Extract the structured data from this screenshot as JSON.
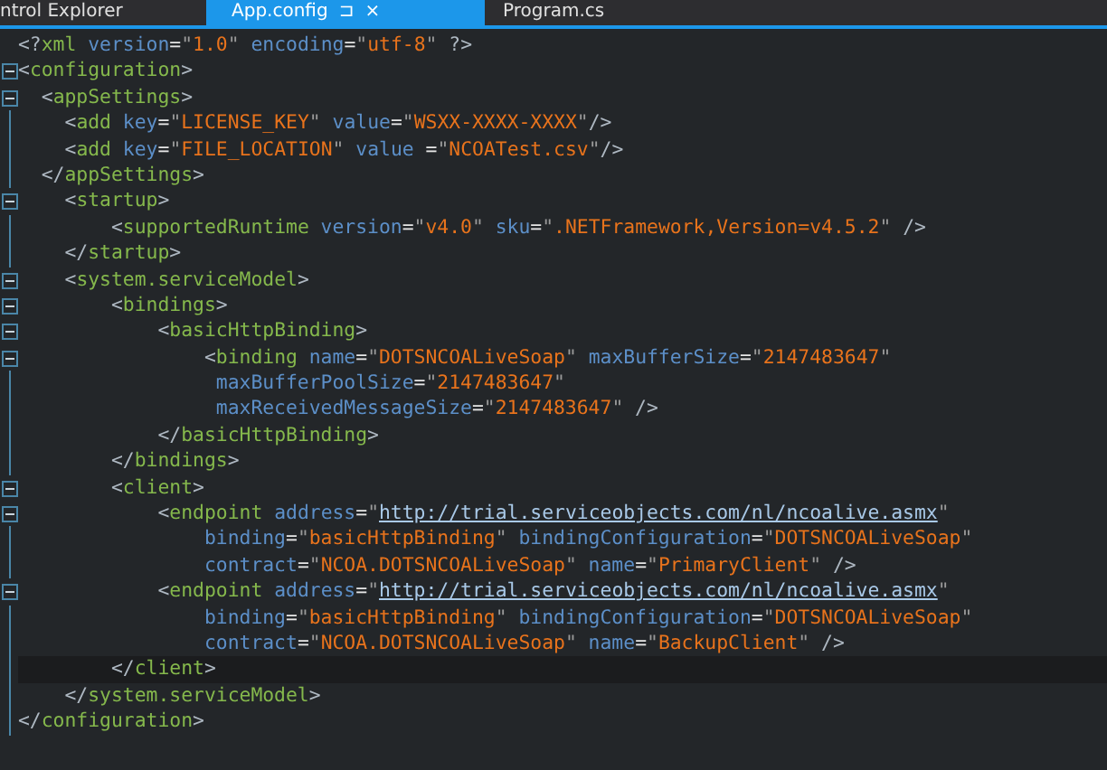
{
  "tabs": [
    {
      "label": "ntrol Explorer",
      "selected": false
    },
    {
      "label": "App.config",
      "selected": true,
      "pin": "⊐",
      "close": "×"
    },
    {
      "label": "Program.cs",
      "selected": false
    }
  ],
  "lines": [
    {
      "fold": false,
      "current": false,
      "tokens": [
        {
          "kind": "punct",
          "text": "<?"
        },
        {
          "kind": "tag",
          "text": "xml"
        },
        {
          "kind": "attr",
          "text": " version"
        },
        {
          "kind": "eq",
          "text": "="
        },
        {
          "kind": "quote",
          "text": "\""
        },
        {
          "kind": "value",
          "text": "1.0"
        },
        {
          "kind": "quote",
          "text": "\""
        },
        {
          "kind": "attr",
          "text": " encoding"
        },
        {
          "kind": "eq",
          "text": "="
        },
        {
          "kind": "quote",
          "text": "\""
        },
        {
          "kind": "value",
          "text": "utf-8"
        },
        {
          "kind": "quote",
          "text": "\""
        },
        {
          "kind": "punct",
          "text": " ?>"
        }
      ]
    },
    {
      "fold": true,
      "current": false,
      "tokens": [
        {
          "kind": "punct",
          "text": "<"
        },
        {
          "kind": "tag",
          "text": "configuration"
        },
        {
          "kind": "punct",
          "text": ">"
        }
      ]
    },
    {
      "fold": true,
      "current": false,
      "tokens": [
        {
          "kind": "punct",
          "text": "  <"
        },
        {
          "kind": "tag",
          "text": "appSettings"
        },
        {
          "kind": "punct",
          "text": ">"
        }
      ]
    },
    {
      "fold": false,
      "current": false,
      "tokens": [
        {
          "kind": "punct",
          "text": "    <"
        },
        {
          "kind": "tag",
          "text": "add"
        },
        {
          "kind": "attr",
          "text": " key"
        },
        {
          "kind": "eq",
          "text": "="
        },
        {
          "kind": "quote",
          "text": "\""
        },
        {
          "kind": "value",
          "text": "LICENSE_KEY"
        },
        {
          "kind": "quote",
          "text": "\""
        },
        {
          "kind": "attr",
          "text": " value"
        },
        {
          "kind": "eq",
          "text": "="
        },
        {
          "kind": "quote",
          "text": "\""
        },
        {
          "kind": "value",
          "text": "WSXX-XXXX-XXXX"
        },
        {
          "kind": "quote",
          "text": "\""
        },
        {
          "kind": "punct",
          "text": "/>"
        }
      ]
    },
    {
      "fold": false,
      "current": false,
      "tokens": [
        {
          "kind": "punct",
          "text": "    <"
        },
        {
          "kind": "tag",
          "text": "add"
        },
        {
          "kind": "attr",
          "text": " key"
        },
        {
          "kind": "eq",
          "text": "="
        },
        {
          "kind": "quote",
          "text": "\""
        },
        {
          "kind": "value",
          "text": "FILE_LOCATION"
        },
        {
          "kind": "quote",
          "text": "\""
        },
        {
          "kind": "attr",
          "text": " value "
        },
        {
          "kind": "eq",
          "text": "="
        },
        {
          "kind": "quote",
          "text": "\""
        },
        {
          "kind": "value",
          "text": "NCOATest.csv"
        },
        {
          "kind": "quote",
          "text": "\""
        },
        {
          "kind": "punct",
          "text": "/>"
        }
      ]
    },
    {
      "fold": false,
      "current": false,
      "tokens": [
        {
          "kind": "punct",
          "text": "  </"
        },
        {
          "kind": "tag",
          "text": "appSettings"
        },
        {
          "kind": "punct",
          "text": ">"
        }
      ]
    },
    {
      "fold": true,
      "current": false,
      "tokens": [
        {
          "kind": "punct",
          "text": "    <"
        },
        {
          "kind": "tag",
          "text": "startup"
        },
        {
          "kind": "punct",
          "text": ">"
        }
      ]
    },
    {
      "fold": false,
      "current": false,
      "tokens": [
        {
          "kind": "punct",
          "text": "        <"
        },
        {
          "kind": "tag",
          "text": "supportedRuntime"
        },
        {
          "kind": "attr",
          "text": " version"
        },
        {
          "kind": "eq",
          "text": "="
        },
        {
          "kind": "quote",
          "text": "\""
        },
        {
          "kind": "value",
          "text": "v4.0"
        },
        {
          "kind": "quote",
          "text": "\""
        },
        {
          "kind": "attr",
          "text": " sku"
        },
        {
          "kind": "eq",
          "text": "="
        },
        {
          "kind": "quote",
          "text": "\""
        },
        {
          "kind": "value",
          "text": ".NETFramework,Version=v4.5.2"
        },
        {
          "kind": "quote",
          "text": "\""
        },
        {
          "kind": "punct",
          "text": " />"
        }
      ]
    },
    {
      "fold": false,
      "current": false,
      "tokens": [
        {
          "kind": "punct",
          "text": "    </"
        },
        {
          "kind": "tag",
          "text": "startup"
        },
        {
          "kind": "punct",
          "text": ">"
        }
      ]
    },
    {
      "fold": true,
      "current": false,
      "tokens": [
        {
          "kind": "punct",
          "text": "    <"
        },
        {
          "kind": "tag",
          "text": "system.serviceModel"
        },
        {
          "kind": "punct",
          "text": ">"
        }
      ]
    },
    {
      "fold": true,
      "current": false,
      "tokens": [
        {
          "kind": "punct",
          "text": "        <"
        },
        {
          "kind": "tag",
          "text": "bindings"
        },
        {
          "kind": "punct",
          "text": ">"
        }
      ]
    },
    {
      "fold": true,
      "current": false,
      "tokens": [
        {
          "kind": "punct",
          "text": "            <"
        },
        {
          "kind": "tag",
          "text": "basicHttpBinding"
        },
        {
          "kind": "punct",
          "text": ">"
        }
      ]
    },
    {
      "fold": true,
      "current": false,
      "tokens": [
        {
          "kind": "punct",
          "text": "                <"
        },
        {
          "kind": "tag",
          "text": "binding"
        },
        {
          "kind": "attr",
          "text": " name"
        },
        {
          "kind": "eq",
          "text": "="
        },
        {
          "kind": "quote",
          "text": "\""
        },
        {
          "kind": "value",
          "text": "DOTSNCOALiveSoap"
        },
        {
          "kind": "quote",
          "text": "\""
        },
        {
          "kind": "attr",
          "text": " maxBufferSize"
        },
        {
          "kind": "eq",
          "text": "="
        },
        {
          "kind": "quote",
          "text": "\""
        },
        {
          "kind": "value",
          "text": "2147483647"
        },
        {
          "kind": "quote",
          "text": "\""
        }
      ]
    },
    {
      "fold": false,
      "current": false,
      "tokens": [
        {
          "kind": "attr",
          "text": "                 maxBufferPoolSize"
        },
        {
          "kind": "eq",
          "text": "="
        },
        {
          "kind": "quote",
          "text": "\""
        },
        {
          "kind": "value",
          "text": "2147483647"
        },
        {
          "kind": "quote",
          "text": "\""
        }
      ]
    },
    {
      "fold": false,
      "current": false,
      "tokens": [
        {
          "kind": "attr",
          "text": "                 maxReceivedMessageSize"
        },
        {
          "kind": "eq",
          "text": "="
        },
        {
          "kind": "quote",
          "text": "\""
        },
        {
          "kind": "value",
          "text": "2147483647"
        },
        {
          "kind": "quote",
          "text": "\""
        },
        {
          "kind": "punct",
          "text": " />"
        }
      ]
    },
    {
      "fold": false,
      "current": false,
      "tokens": [
        {
          "kind": "punct",
          "text": "            </"
        },
        {
          "kind": "tag",
          "text": "basicHttpBinding"
        },
        {
          "kind": "punct",
          "text": ">"
        }
      ]
    },
    {
      "fold": false,
      "current": false,
      "tokens": [
        {
          "kind": "punct",
          "text": "        </"
        },
        {
          "kind": "tag",
          "text": "bindings"
        },
        {
          "kind": "punct",
          "text": ">"
        }
      ]
    },
    {
      "fold": true,
      "current": false,
      "tokens": [
        {
          "kind": "punct",
          "text": "        <"
        },
        {
          "kind": "tag",
          "text": "client"
        },
        {
          "kind": "punct",
          "text": ">"
        }
      ]
    },
    {
      "fold": true,
      "current": false,
      "tokens": [
        {
          "kind": "punct",
          "text": "            <"
        },
        {
          "kind": "tag",
          "text": "endpoint"
        },
        {
          "kind": "attr",
          "text": " address"
        },
        {
          "kind": "eq",
          "text": "="
        },
        {
          "kind": "quote",
          "text": "\""
        },
        {
          "kind": "link",
          "text": "http://trial.serviceobjects.com/nl/ncoalive.asmx"
        },
        {
          "kind": "quote",
          "text": "\""
        }
      ]
    },
    {
      "fold": false,
      "current": false,
      "tokens": [
        {
          "kind": "attr",
          "text": "                binding"
        },
        {
          "kind": "eq",
          "text": "="
        },
        {
          "kind": "quote",
          "text": "\""
        },
        {
          "kind": "value",
          "text": "basicHttpBinding"
        },
        {
          "kind": "quote",
          "text": "\""
        },
        {
          "kind": "attr",
          "text": " bindingConfiguration"
        },
        {
          "kind": "eq",
          "text": "="
        },
        {
          "kind": "quote",
          "text": "\""
        },
        {
          "kind": "value",
          "text": "DOTSNCOALiveSoap"
        },
        {
          "kind": "quote",
          "text": "\""
        }
      ]
    },
    {
      "fold": false,
      "current": false,
      "tokens": [
        {
          "kind": "attr",
          "text": "                contract"
        },
        {
          "kind": "eq",
          "text": "="
        },
        {
          "kind": "quote",
          "text": "\""
        },
        {
          "kind": "value",
          "text": "NCOA.DOTSNCOALiveSoap"
        },
        {
          "kind": "quote",
          "text": "\""
        },
        {
          "kind": "attr",
          "text": " name"
        },
        {
          "kind": "eq",
          "text": "="
        },
        {
          "kind": "quote",
          "text": "\""
        },
        {
          "kind": "value",
          "text": "PrimaryClient"
        },
        {
          "kind": "quote",
          "text": "\""
        },
        {
          "kind": "punct",
          "text": " />"
        }
      ]
    },
    {
      "fold": true,
      "current": false,
      "tokens": [
        {
          "kind": "punct",
          "text": "            <"
        },
        {
          "kind": "tag",
          "text": "endpoint"
        },
        {
          "kind": "attr",
          "text": " address"
        },
        {
          "kind": "eq",
          "text": "="
        },
        {
          "kind": "quote",
          "text": "\""
        },
        {
          "kind": "link",
          "text": "http://trial.serviceobjects.com/nl/ncoalive.asmx"
        },
        {
          "kind": "quote",
          "text": "\""
        }
      ]
    },
    {
      "fold": false,
      "current": false,
      "tokens": [
        {
          "kind": "attr",
          "text": "                binding"
        },
        {
          "kind": "eq",
          "text": "="
        },
        {
          "kind": "quote",
          "text": "\""
        },
        {
          "kind": "value",
          "text": "basicHttpBinding"
        },
        {
          "kind": "quote",
          "text": "\""
        },
        {
          "kind": "attr",
          "text": " bindingConfiguration"
        },
        {
          "kind": "eq",
          "text": "="
        },
        {
          "kind": "quote",
          "text": "\""
        },
        {
          "kind": "value",
          "text": "DOTSNCOALiveSoap"
        },
        {
          "kind": "quote",
          "text": "\""
        }
      ]
    },
    {
      "fold": false,
      "current": false,
      "tokens": [
        {
          "kind": "attr",
          "text": "                contract"
        },
        {
          "kind": "eq",
          "text": "="
        },
        {
          "kind": "quote",
          "text": "\""
        },
        {
          "kind": "value",
          "text": "NCOA.DOTSNCOALiveSoap"
        },
        {
          "kind": "quote",
          "text": "\""
        },
        {
          "kind": "attr",
          "text": " name"
        },
        {
          "kind": "eq",
          "text": "="
        },
        {
          "kind": "quote",
          "text": "\""
        },
        {
          "kind": "value",
          "text": "BackupClient"
        },
        {
          "kind": "quote",
          "text": "\""
        },
        {
          "kind": "punct",
          "text": " />"
        }
      ]
    },
    {
      "fold": false,
      "current": true,
      "tokens": [
        {
          "kind": "punct",
          "text": "        </"
        },
        {
          "kind": "tag",
          "text": "client"
        },
        {
          "kind": "punct",
          "text": ">"
        }
      ]
    },
    {
      "fold": false,
      "current": false,
      "tokens": [
        {
          "kind": "punct",
          "text": "    </"
        },
        {
          "kind": "tag",
          "text": "system.serviceModel"
        },
        {
          "kind": "punct",
          "text": ">"
        }
      ]
    },
    {
      "fold": false,
      "current": false,
      "tokens": [
        {
          "kind": "punct",
          "text": "</"
        },
        {
          "kind": "tag",
          "text": "configuration"
        },
        {
          "kind": "punct",
          "text": ">"
        }
      ]
    }
  ]
}
